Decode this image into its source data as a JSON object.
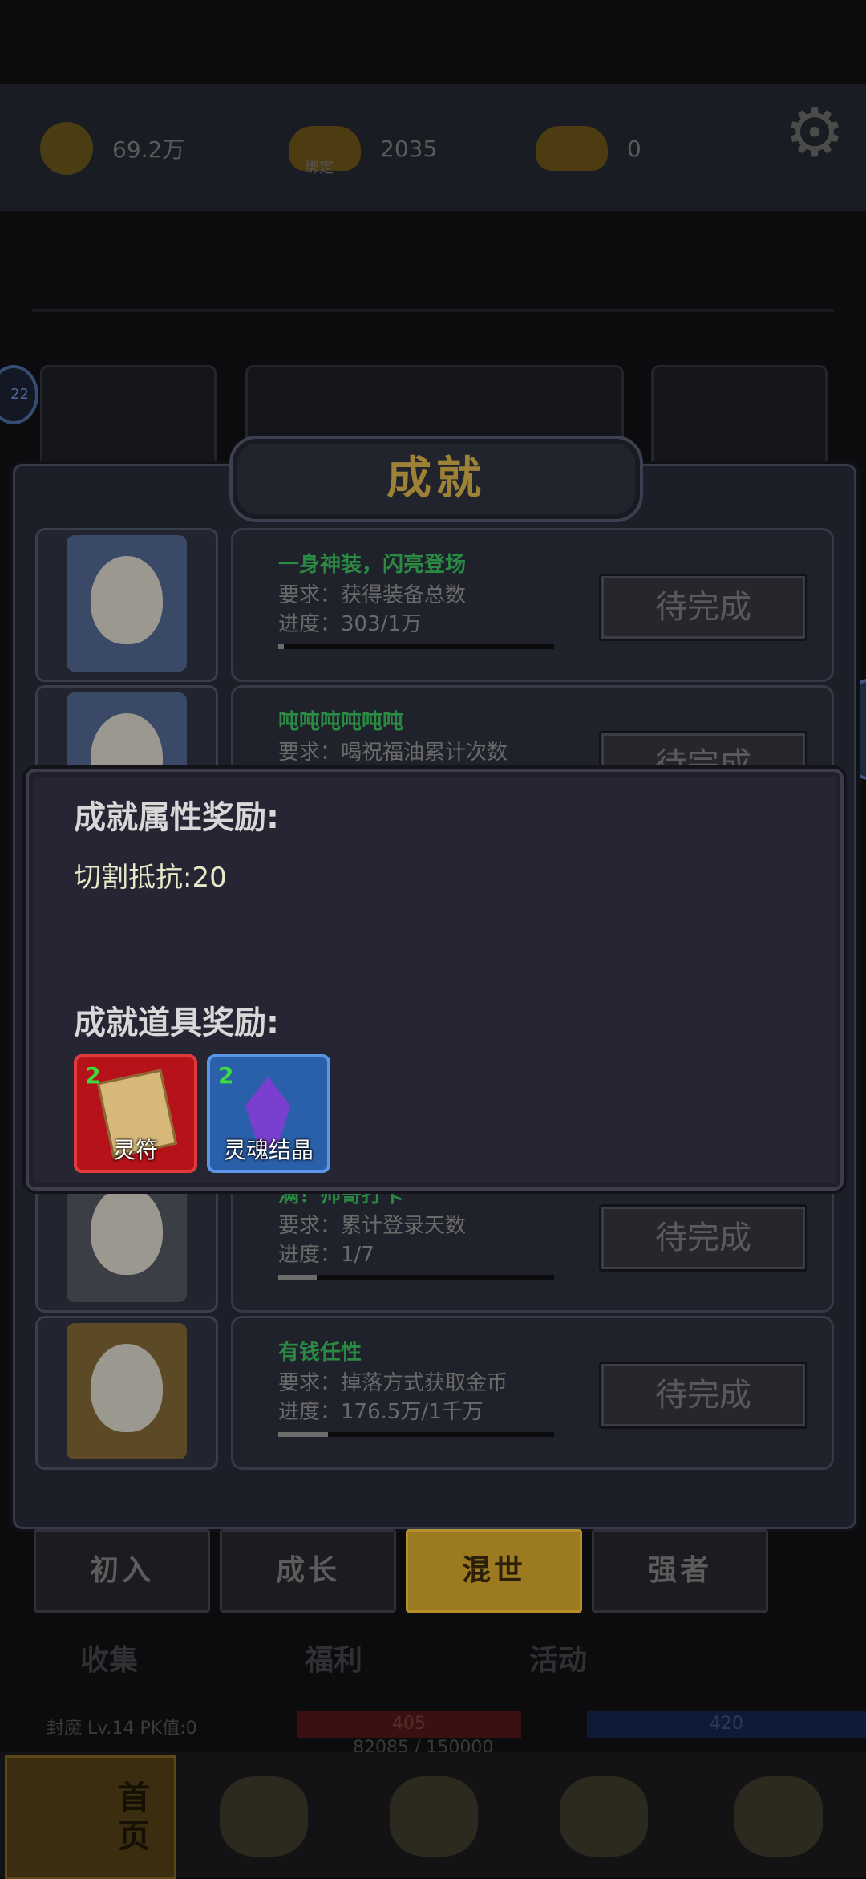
{
  "header": {
    "coins": "69.2万",
    "bound_ingot": "2035",
    "bound_tag": "绑定",
    "ingot": "0"
  },
  "side_badge": "22",
  "dialog": {
    "title": "成就",
    "achievements": [
      {
        "name": "一身神装，闪亮登场",
        "requirement": "要求：获得装备总数",
        "progress": "进度：303/1万",
        "progress_fraction": 0.02,
        "button": "待完成"
      },
      {
        "name": "吨吨吨吨吨吨",
        "requirement": "要求：喝祝福油累计次数",
        "progress": "",
        "progress_fraction": 0,
        "button": "待完成"
      },
      {
        "name": "满！帅哥打卡",
        "requirement": "要求：累计登录天数",
        "progress": "进度：1/7",
        "progress_fraction": 0.14,
        "button": "待完成"
      },
      {
        "name": "有钱任性",
        "requirement": "要求：掉落方式获取金币",
        "progress": "进度：176.5万/1千万",
        "progress_fraction": 0.18,
        "button": "待完成"
      }
    ]
  },
  "reward_popup": {
    "attr_heading": "成就属性奖励:",
    "attr_value": "切割抵抗:20",
    "item_heading": "成就道具奖励:",
    "items": [
      {
        "count": "2",
        "name": "灵符"
      },
      {
        "count": "2",
        "name": "灵魂结晶"
      }
    ]
  },
  "categories": [
    "初入",
    "成长",
    "混世",
    "强者"
  ],
  "active_category": "混世",
  "subtabs": [
    "收集",
    "福利",
    "活动"
  ],
  "status": {
    "line": "封魔 Lv.14 PK值:0",
    "hp": "405",
    "mp": "420",
    "exp": "82085 / 150000"
  },
  "bottom_nav": {
    "home": "首页"
  },
  "colors": {
    "accent_gold": "#9b7a22",
    "achievement_name": "#2a8a43",
    "item_count": "#3ddc3d"
  }
}
